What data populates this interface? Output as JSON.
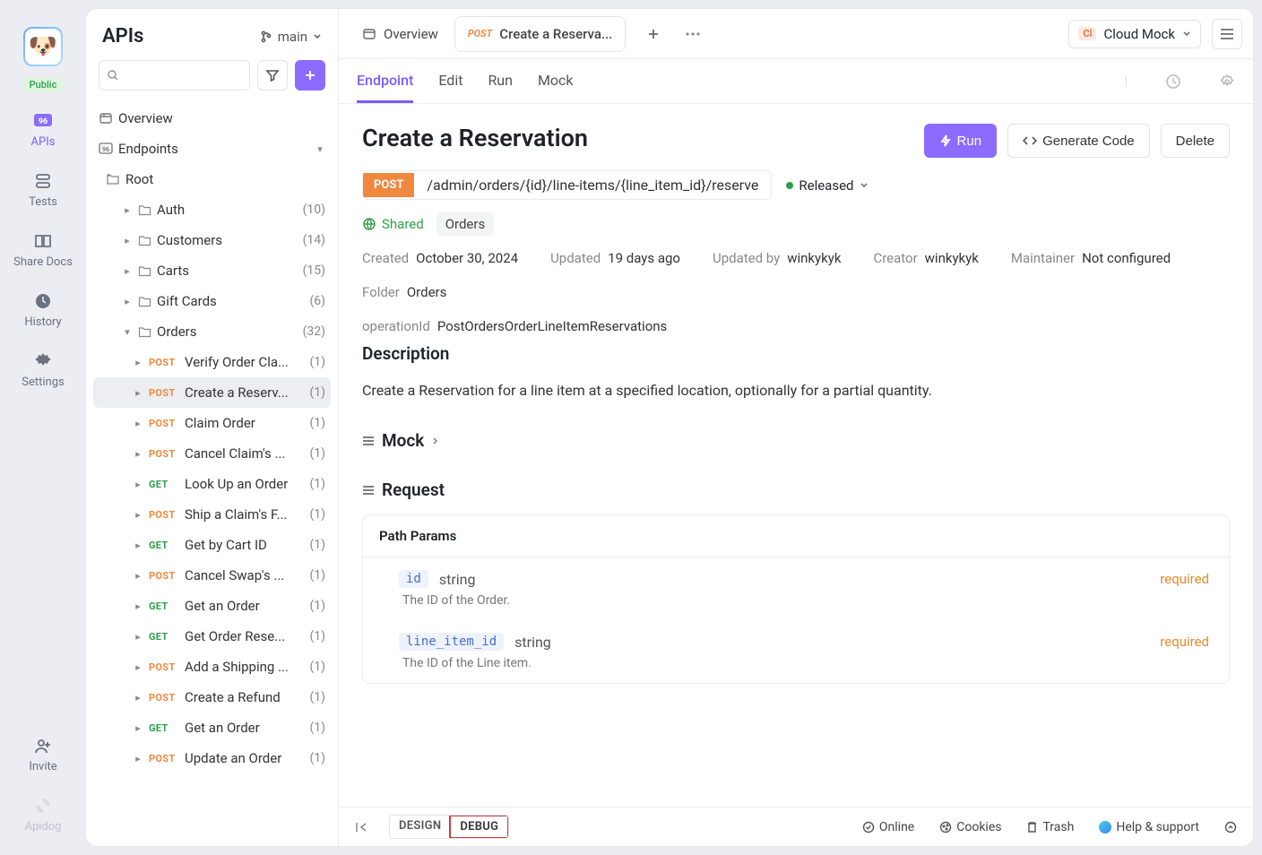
{
  "rail": {
    "public": "Public",
    "items": [
      {
        "key": "apis",
        "label": "APIs"
      },
      {
        "key": "tests",
        "label": "Tests"
      },
      {
        "key": "share",
        "label": "Share Docs"
      },
      {
        "key": "history",
        "label": "History"
      },
      {
        "key": "settings",
        "label": "Settings"
      },
      {
        "key": "invite",
        "label": "Invite"
      }
    ],
    "brand": "Apidog"
  },
  "sidebar": {
    "title": "APIs",
    "branch": "main",
    "overview": "Overview",
    "endpoints_label": "Endpoints",
    "tree": {
      "root": "Root",
      "folders": [
        {
          "name": "Auth",
          "count": "(10)"
        },
        {
          "name": "Customers",
          "count": "(14)"
        },
        {
          "name": "Carts",
          "count": "(15)"
        },
        {
          "name": "Gift Cards",
          "count": "(6)"
        },
        {
          "name": "Orders",
          "count": "(32)",
          "expanded": true
        }
      ],
      "orders_children": [
        {
          "method": "POST",
          "name": "Verify Order Cla...",
          "count": "(1)"
        },
        {
          "method": "POST",
          "name": "Create a Reserv...",
          "count": "(1)",
          "selected": true
        },
        {
          "method": "POST",
          "name": "Claim Order",
          "count": "(1)"
        },
        {
          "method": "POST",
          "name": "Cancel Claim's ...",
          "count": "(1)"
        },
        {
          "method": "GET",
          "name": "Look Up an Order",
          "count": "(1)"
        },
        {
          "method": "POST",
          "name": "Ship a Claim's F...",
          "count": "(1)"
        },
        {
          "method": "GET",
          "name": "Get by Cart ID",
          "count": "(1)"
        },
        {
          "method": "POST",
          "name": "Cancel Swap's ...",
          "count": "(1)"
        },
        {
          "method": "GET",
          "name": "Get an Order",
          "count": "(1)"
        },
        {
          "method": "GET",
          "name": "Get Order Rese...",
          "count": "(1)"
        },
        {
          "method": "POST",
          "name": "Add a Shipping ...",
          "count": "(1)"
        },
        {
          "method": "POST",
          "name": "Create a Refund",
          "count": "(1)"
        },
        {
          "method": "GET",
          "name": "Get an Order",
          "count": "(1)"
        },
        {
          "method": "POST",
          "name": "Update an Order",
          "count": "(1)"
        }
      ]
    }
  },
  "tabs": {
    "overview": "Overview",
    "active_method": "POST",
    "active_label": "Create a Reserva..."
  },
  "env": {
    "chip": "Cl",
    "name": "Cloud Mock"
  },
  "subtabs": [
    "Endpoint",
    "Edit",
    "Run",
    "Mock"
  ],
  "page": {
    "title": "Create a Reservation",
    "run": "Run",
    "gen": "Generate Code",
    "delete": "Delete",
    "method": "POST",
    "path": "/admin/orders/{id}/line-items/{line_item_id}/reserve",
    "status": "Released",
    "shared": "Shared",
    "tag": "Orders",
    "meta": {
      "created_l": "Created",
      "created_v": "October 30, 2024",
      "updated_l": "Updated",
      "updated_v": "19 days ago",
      "updatedby_l": "Updated by",
      "updatedby_v": "winkykyk",
      "creator_l": "Creator",
      "creator_v": "winkykyk",
      "maint_l": "Maintainer",
      "maint_v": "Not configured",
      "folder_l": "Folder",
      "folder_v": "Orders",
      "opid_l": "operationId",
      "opid_v": "PostOrdersOrderLineItemReservations"
    },
    "desc_h": "Description",
    "desc": "Create a Reservation for a line item at a specified location, optionally for a partial quantity.",
    "mock_h": "Mock",
    "req_h": "Request",
    "params_h": "Path Params",
    "params": [
      {
        "name": "id",
        "type": "string",
        "req": "required",
        "desc": "The ID of the Order."
      },
      {
        "name": "line_item_id",
        "type": "string",
        "req": "required",
        "desc": "The ID of the Line item."
      }
    ]
  },
  "footer": {
    "design": "DESIGN",
    "debug": "DEBUG",
    "online": "Online",
    "cookies": "Cookies",
    "trash": "Trash",
    "help": "Help & support"
  }
}
